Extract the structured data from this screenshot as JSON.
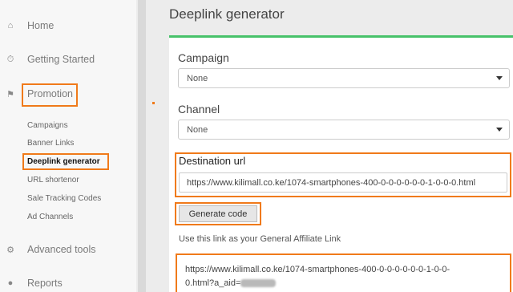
{
  "sidebar": {
    "items": [
      {
        "label": "Home",
        "icon": "home-icon"
      },
      {
        "label": "Getting Started",
        "icon": "timer-icon"
      },
      {
        "label": "Promotion",
        "icon": "megaphone-icon"
      },
      {
        "label": "Advanced tools",
        "icon": "gear-icon"
      },
      {
        "label": "Reports",
        "icon": "chart-icon"
      }
    ],
    "sub_items": [
      {
        "label": "Campaigns"
      },
      {
        "label": "Banner Links"
      },
      {
        "label": "Deeplink generator"
      },
      {
        "label": "URL shortenor"
      },
      {
        "label": "Sale Tracking Codes"
      },
      {
        "label": "Ad Channels"
      }
    ]
  },
  "main": {
    "title": "Deeplink generator",
    "campaign": {
      "label": "Campaign",
      "value": "None"
    },
    "channel": {
      "label": "Channel",
      "value": "None"
    },
    "destination": {
      "label": "Destination url",
      "value": "https://www.kilimall.co.ke/1074-smartphones-400-0-0-0-0-0-0-1-0-0-0.html"
    },
    "generate_label": "Generate code",
    "affiliate_text": "Use this link as your General Affiliate Link",
    "result": {
      "line1": "https://www.kilimall.co.ke/1074-smartphones-400-0-0-0-0-0-0-1-0-0-",
      "line2": "0.html?a_aid="
    }
  },
  "colors": {
    "accent": "#f07a1a",
    "panel_top": "#47c26a"
  }
}
